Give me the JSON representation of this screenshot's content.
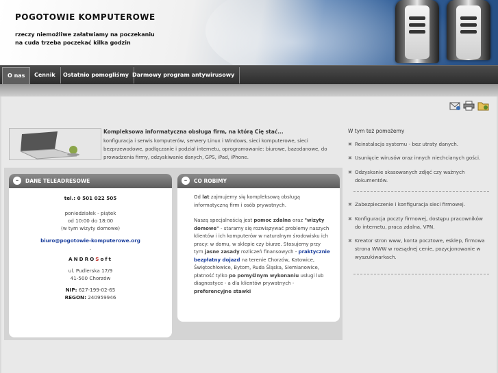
{
  "header": {
    "title": "POGOTOWIE KOMPUTEROWE",
    "tagline_line1": "rzeczy niemożliwe załatwiamy na poczekaniu",
    "tagline_line2": "na cuda trzeba poczekać kilka godzin"
  },
  "nav": {
    "items": [
      {
        "label": "O nas"
      },
      {
        "label": "Cennik"
      },
      {
        "label": "Ostatnio pomogliśmy"
      },
      {
        "label": "Darmowy program antywirusowy"
      }
    ]
  },
  "tools": [
    "email-icon",
    "print-icon",
    "bookmark-folder-icon"
  ],
  "intro": {
    "title": "Kompleksowa informatyczna obsługa firm, na którą Cię stać...",
    "text": "konfiguracja i serwis komputerów, serwery Linux i Windows, sieci komputerowe, sieci bezprzewodowe, podłączanie i podział internetu, oprogramowanie: biurowe, bazodanowe, do prowadzenia firmy, odzyskiwanie danych, GPS, iPad, iPhone."
  },
  "contact_panel": {
    "title": "DANE TELEADRESOWE",
    "phone": "tel.: 0 501 022 505",
    "hours_days": "poniedziałek - piątek",
    "hours_time": "od 10:00 do 18:00",
    "hours_note": "(w tym wizyty domowe)",
    "email": "biuro@pogotowie-komputerowe.org",
    "dot": ".",
    "company_pre": "ANDRO",
    "company_s": "S",
    "company_post": "oft",
    "street": "ul. Pudlerska 17/9",
    "city": "41-500 Chorzów",
    "nip_label": "NIP:",
    "nip": "627-199-02-65",
    "regon_label": "REGON:",
    "regon": "240959946"
  },
  "services_panel": {
    "title": "CO ROBIMY",
    "p1_a": "Od ",
    "p1_b": "lat",
    "p1_c": " zajmujemy się kompleksową obsługą informatyczną firm i osób prywatnych.",
    "p2_a": "Naszą specjalnością jest ",
    "p2_b": "pomoc zdalna",
    "p2_c": " oraz ",
    "p2_d": "\"wizyty domowe\"",
    "p2_e": " - staramy się rozwiązywać problemy naszych klientów i ich komputerów w naturalnym środowisku ich pracy: w domu, w sklepie czy biurze. Stosujemy przy tym ",
    "p2_f": "jasne zasady",
    "p2_g": " rozliczeń finansowych - ",
    "p2_h": "praktycznie bezpłatny dojazd",
    "p2_i": " na terenie Chorzów, Katowice, Świętochłowice, Bytom, Ruda Śląska, Siemianowice, płatność tylko ",
    "p2_j": "po pomyślnym wykonaniu",
    "p2_k": " usługi lub diagnostyce - a dla klientów prywatnych - ",
    "p2_l": "preferencyjne stawki"
  },
  "sidebar": {
    "heading": "W tym też pomożemy",
    "items_a": [
      "Reinstalacja systemu - bez utraty danych.",
      "Usunięcie wirusów oraz innych niechcianych gości.",
      "Odzyskanie skasowanych zdjęć czy ważnych dokumentów."
    ],
    "items_b": [
      "Zabezpieczenie i konfiguracja sieci firmowej.",
      "Konfiguracja poczty firmowej, dostępu pracowników do internetu, praca zdalna, VPN.",
      "Kreator stron www, konta pocztowe, esklep, firmowa strona WWW w rozsądnej cenie, pozycjonowanie w wyszukiwarkach."
    ]
  }
}
